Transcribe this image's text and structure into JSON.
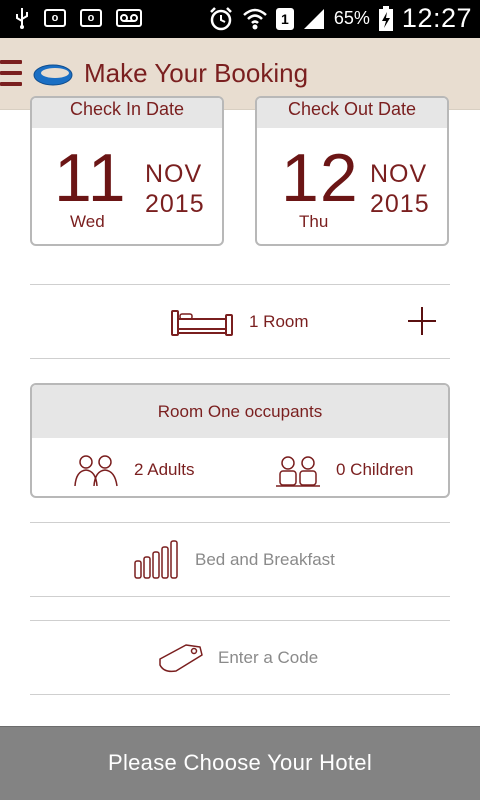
{
  "status_bar": {
    "battery": "65%",
    "time": "12:27",
    "sim_slot": "1",
    "icons": [
      "usb-icon",
      "outlook-icon",
      "outlook-icon",
      "voicemail-icon",
      "alarm-icon",
      "wifi-icon",
      "sim-icon",
      "signal-icon",
      "battery-charging-icon"
    ]
  },
  "app_bar": {
    "title": "Make Your Booking"
  },
  "check_in": {
    "header": "Check In Date",
    "day": "11",
    "weekday": "Wed",
    "month": "NOV",
    "year": "2015"
  },
  "check_out": {
    "header": "Check Out Date",
    "day": "12",
    "weekday": "Thu",
    "month": "NOV",
    "year": "2015"
  },
  "rooms": {
    "label": "1 Room"
  },
  "occupants": {
    "header": "Room One occupants",
    "adults": "2 Adults",
    "children": "0 Children"
  },
  "board": {
    "label": "Bed and Breakfast"
  },
  "promo": {
    "placeholder": "Enter a Code"
  },
  "cta": {
    "label": "Please Choose Your Hotel"
  },
  "colors": {
    "accent": "#7a1f1f",
    "appbar_bg": "#e8ddd0",
    "cta_bg": "#838383"
  }
}
